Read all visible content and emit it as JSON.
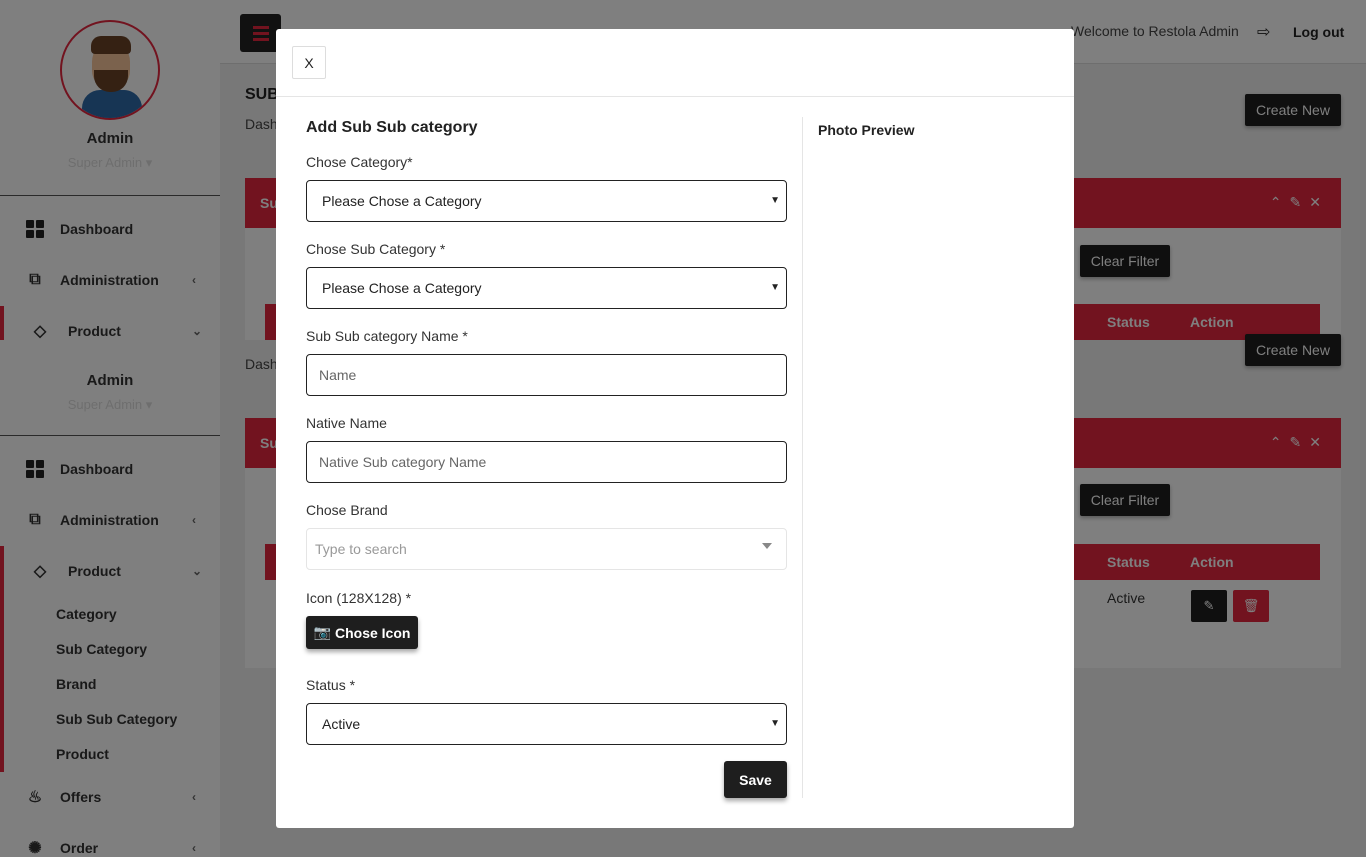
{
  "sidebar": {
    "profile_name": "Admin",
    "profile_role": "Super Admin",
    "nav": {
      "dashboard": "Dashboard",
      "administration": "Administration",
      "product": "Product",
      "offers": "Offers",
      "order": "Order"
    },
    "product_sub": [
      "Category",
      "Sub Category",
      "Brand",
      "Sub Sub Category",
      "Product"
    ]
  },
  "topbar": {
    "welcome": "Welcome to Restola Admin",
    "logout": "Log out"
  },
  "page": {
    "title": "SUB",
    "breadcrumb": "Dash",
    "create_new": "Create New",
    "panel_title": "Su",
    "clear_filter": "Clear Filter",
    "columns": {
      "status": "Status",
      "action": "Action"
    },
    "row_status": "Active"
  },
  "modal": {
    "close_label": "X",
    "form_title": "Add Sub Sub category",
    "category_label": "Chose Category*",
    "category_value": "Please Chose a Category",
    "subcategory_label": "Chose Sub Category *",
    "subcategory_value": "Please Chose a Category",
    "name_label": "Sub Sub category Name *",
    "name_placeholder": "Name",
    "native_label": "Native Name",
    "native_placeholder": "Native Sub category Name",
    "brand_label": "Chose Brand",
    "brand_placeholder": "Type to search",
    "icon_label": "Icon (128X128) *",
    "icon_button": "Chose Icon",
    "status_label": "Status *",
    "status_value": "Active",
    "save_label": "Save",
    "preview_title": "Photo Preview"
  },
  "colors": {
    "accent": "#e5263f",
    "dark": "#1e1e1e"
  }
}
